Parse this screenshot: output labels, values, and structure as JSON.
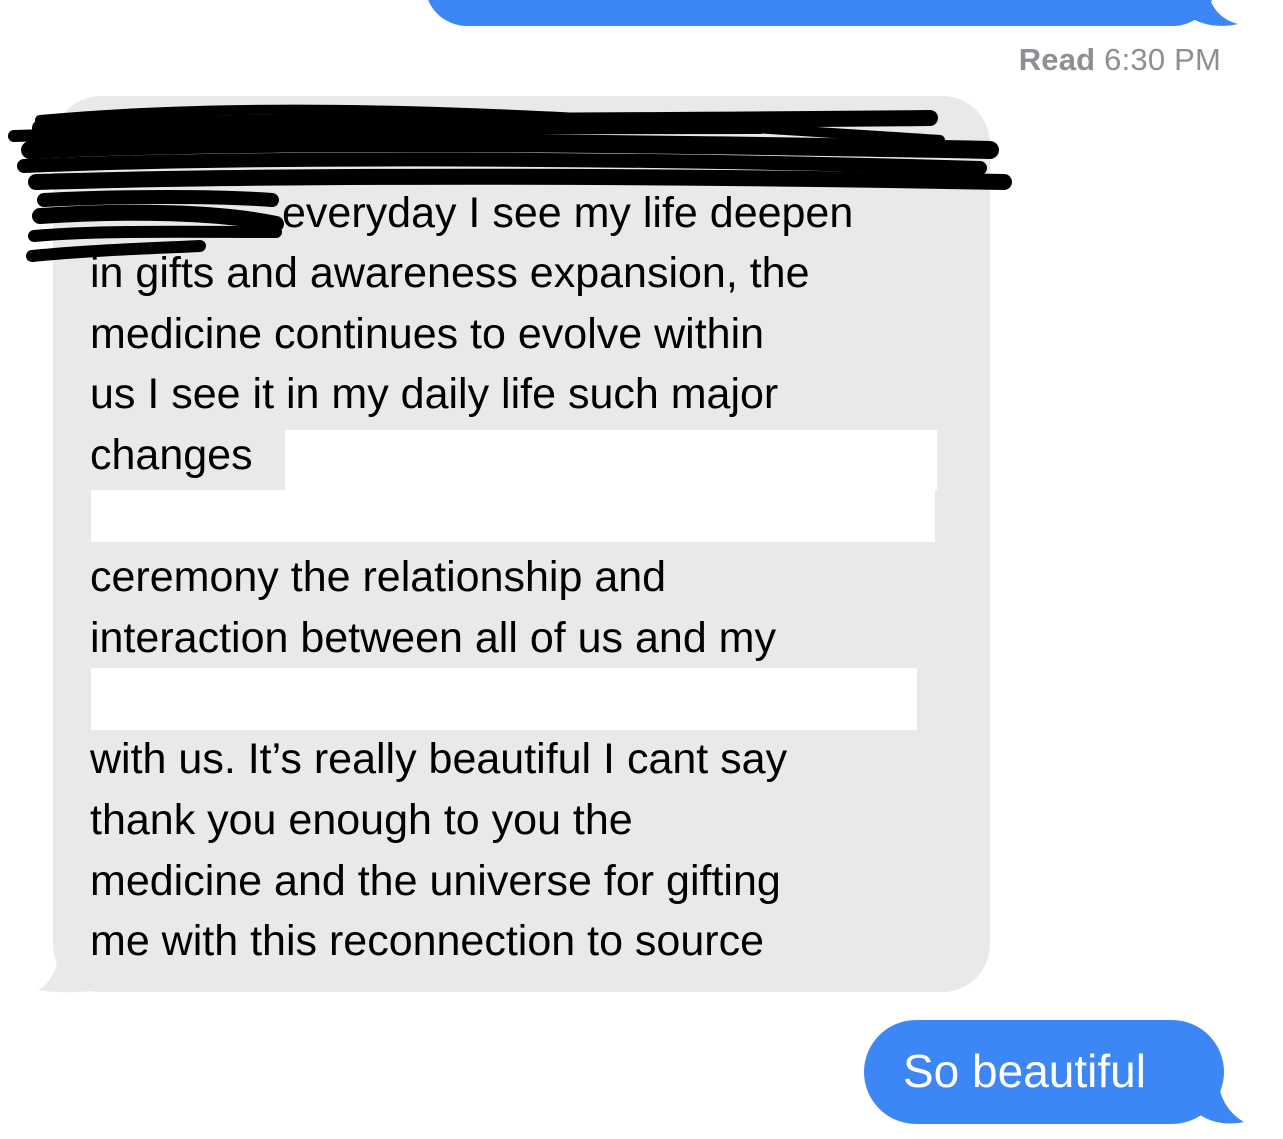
{
  "conversation": {
    "read_receipt": {
      "label": "Read",
      "time": "6:30 PM"
    },
    "incoming_message": {
      "lines": [
        "everyday I see my life deepen",
        "in gifts and awareness expansion, the",
        "medicine continues to evolve within",
        "us I see it in my daily life such major",
        "changes",
        "ceremony the relationship and",
        "interaction between all of us and my",
        "with us. It’s really beautiful I cant say",
        "thank you enough to you the",
        "medicine and the universe for gifting",
        "me with this reconnection to source"
      ]
    },
    "outgoing_message": {
      "text": "So beautiful"
    },
    "colors": {
      "outgoing_bubble": "#3d86f5",
      "incoming_bubble": "#e9e9eb",
      "receipt_text": "#8e8e93",
      "redaction_marker": "#000000",
      "redaction_box": "#ffffff"
    }
  }
}
